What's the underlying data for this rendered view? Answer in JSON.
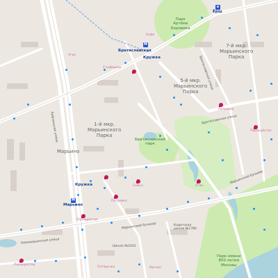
{
  "map": {
    "districts": [
      {
        "id": "mkr1",
        "lines": [
          "1-й мкр.",
          "Марьинского",
          "Парка"
        ]
      },
      {
        "id": "mkr5",
        "lines": [
          "5-й мкр.",
          "Марьинского",
          "Парка"
        ]
      },
      {
        "id": "mkr7",
        "lines": [
          "7-й мкр.",
          "Марьинского",
          "Парка"
        ]
      },
      {
        "id": "maryino",
        "lines": [
          "Марьино"
        ]
      }
    ],
    "parks": [
      {
        "id": "park-artema",
        "lines": [
          "Парк",
          "Артёма",
          "Боровика"
        ]
      },
      {
        "id": "bratislavsky-park",
        "lines": [
          "Братиславский",
          "парк"
        ]
      },
      {
        "id": "park-850",
        "lines": [
          "Парк имени",
          "850-летия",
          "Москвы"
        ]
      }
    ],
    "streets": [
      {
        "id": "bratislavskaya-st",
        "text": "Братиславская улица"
      },
      {
        "id": "maryinsky-blvd-1",
        "text": "Марьинский бульвар"
      },
      {
        "id": "maryinsky-blvd-2",
        "text": "Марьинский бульвар"
      },
      {
        "id": "lublinskaya",
        "text": "Люблинская улица"
      },
      {
        "id": "novomaryinskaya",
        "text": "Новомарьинская улица"
      },
      {
        "id": "bratislavskaya-2",
        "text": "Братиславская улица"
      }
    ],
    "metro": [
      {
        "id": "m-bratislavskaya",
        "text": "Братиславская"
      },
      {
        "id": "m-maryino",
        "text": "Марьино"
      }
    ],
    "bus_labels": [
      {
        "id": "bus-krujka-1",
        "text": "Кружка"
      },
      {
        "id": "bus-krujka-2",
        "text": "Кружка"
      },
      {
        "id": "bus-ersh",
        "text": "Ёрш"
      }
    ],
    "pois": [
      {
        "id": "poi-petrovka-1",
        "text": "Петровка"
      },
      {
        "id": "poi-perekrestok-1",
        "text": "Перекрёсток"
      },
      {
        "id": "poi-petrovka-2",
        "text": "Петровка"
      },
      {
        "id": "poi-semya",
        "text": "Семья"
      },
      {
        "id": "poi-perekrestok-2",
        "text": "Перекрёсток"
      },
      {
        "id": "poi-atak",
        "text": "Атак"
      },
      {
        "id": "poi-perekrestok-3",
        "text": "Перекрёсток"
      },
      {
        "id": "poi-pyaterochka",
        "text": "Пятёрочка"
      },
      {
        "id": "poi-magnit",
        "text": "Магнит"
      },
      {
        "id": "poi-shkola",
        "text": "Школа №1043"
      },
      {
        "id": "poi-kadetskaya",
        "text": "Кадетская школа №1780"
      },
      {
        "id": "poi-u-kafe",
        "text": "У кафешки"
      },
      {
        "id": "poi-kafe",
        "text": "Кафе"
      },
      {
        "id": "poi-metroshop",
        "text": "Агро"
      }
    ],
    "colors": {
      "background": "#f2efe9",
      "park": "#cdebb0",
      "water": "#aad3df",
      "road": "#ffffff",
      "building": "#d9d0c9",
      "metro_line": "#2255cc",
      "bus_stop": "#1e90ff",
      "poi": "#c2185b"
    }
  }
}
